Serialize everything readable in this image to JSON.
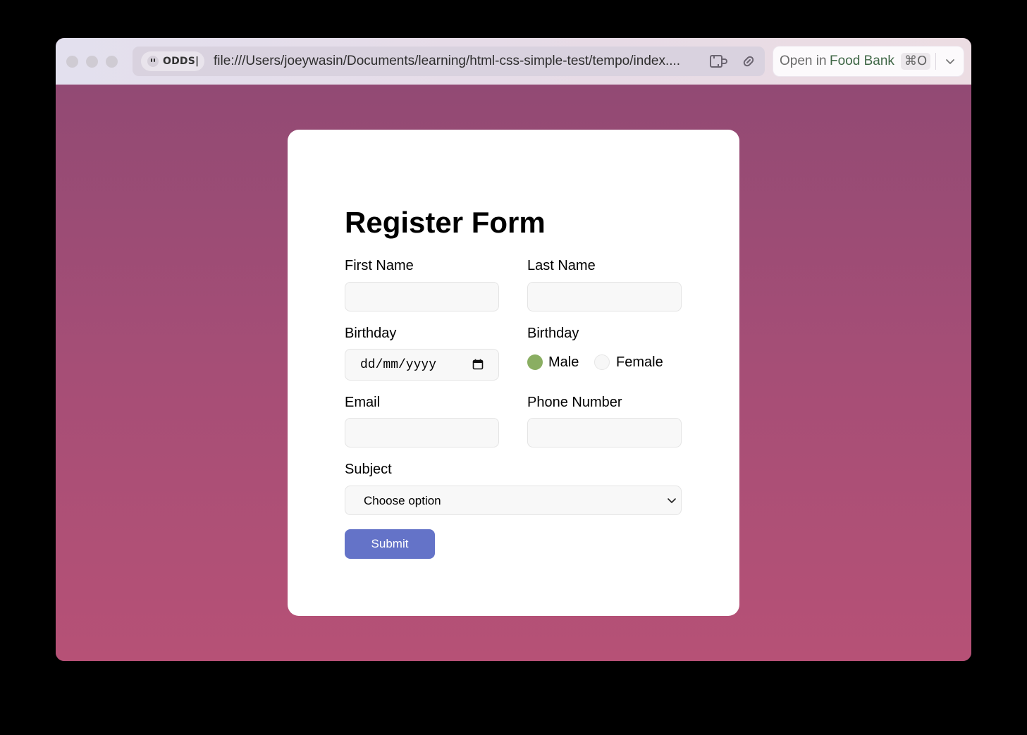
{
  "browser": {
    "profile_label": "ODDS|",
    "url": "file:///Users/joeywasin/Documents/learning/html-css-simple-test/tempo/index....",
    "open_in": {
      "prefix": "Open in",
      "app": "Food Bank",
      "shortcut": "⌘O"
    }
  },
  "form": {
    "title": "Register Form",
    "first_name_label": "First Name",
    "last_name_label": "Last Name",
    "birthday_label": "Birthday",
    "birthday_value": "dd/mm/yyyy",
    "gender_label": "Birthday",
    "gender_options": [
      {
        "label": "Male",
        "selected": true
      },
      {
        "label": "Female",
        "selected": false
      }
    ],
    "email_label": "Email",
    "phone_label": "Phone Number",
    "subject_label": "Subject",
    "subject_selected": "Choose option",
    "submit_label": "Submit"
  },
  "colors": {
    "background_top": "#924a74",
    "background_bottom": "#b65176",
    "radio_selected": "#8aae62",
    "submit_button": "#6473c8"
  },
  "icons": [
    "profile-face-icon",
    "extension-icon",
    "link-icon",
    "chevron-down-icon",
    "calendar-icon"
  ]
}
